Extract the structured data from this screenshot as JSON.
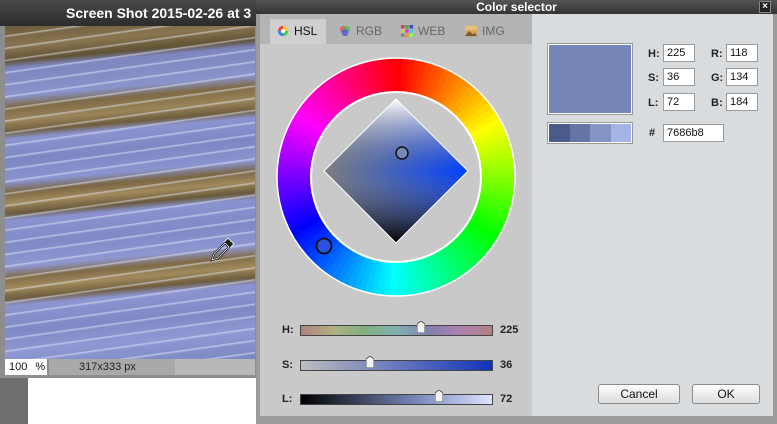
{
  "image_window": {
    "title": "Screen Shot 2015-02-26 at 3",
    "zoom_value": "100",
    "zoom_unit": "%",
    "dimensions": "317x333 px"
  },
  "dialog": {
    "title": "Color selector",
    "close_glyph": "×",
    "tabs": [
      {
        "label": "HSL",
        "icon": "color-wheel-icon",
        "active": true
      },
      {
        "label": "RGB",
        "icon": "rgb-circles-icon",
        "active": false
      },
      {
        "label": "WEB",
        "icon": "web-palette-icon",
        "active": false
      },
      {
        "label": "IMG",
        "icon": "image-icon",
        "active": false
      }
    ],
    "sliders": {
      "h": {
        "label": "H:",
        "value": "225"
      },
      "s": {
        "label": "S:",
        "value": "36"
      },
      "l": {
        "label": "L:",
        "value": "72"
      }
    },
    "fields": {
      "h_label": "H:",
      "h_value": "225",
      "s_label": "S:",
      "s_value": "36",
      "l_label": "L:",
      "l_value": "72",
      "r_label": "R:",
      "r_value": "118",
      "g_label": "G:",
      "g_value": "134",
      "b_label": "B:",
      "b_value": "184",
      "hex_label": "#",
      "hex_value": "7686b8"
    },
    "current_color": "#7686b8",
    "shade_colors": [
      "#4a5a8a",
      "#6474a6",
      "#8494c6",
      "#a4b4e6"
    ],
    "cancel_label": "Cancel",
    "ok_label": "OK"
  }
}
